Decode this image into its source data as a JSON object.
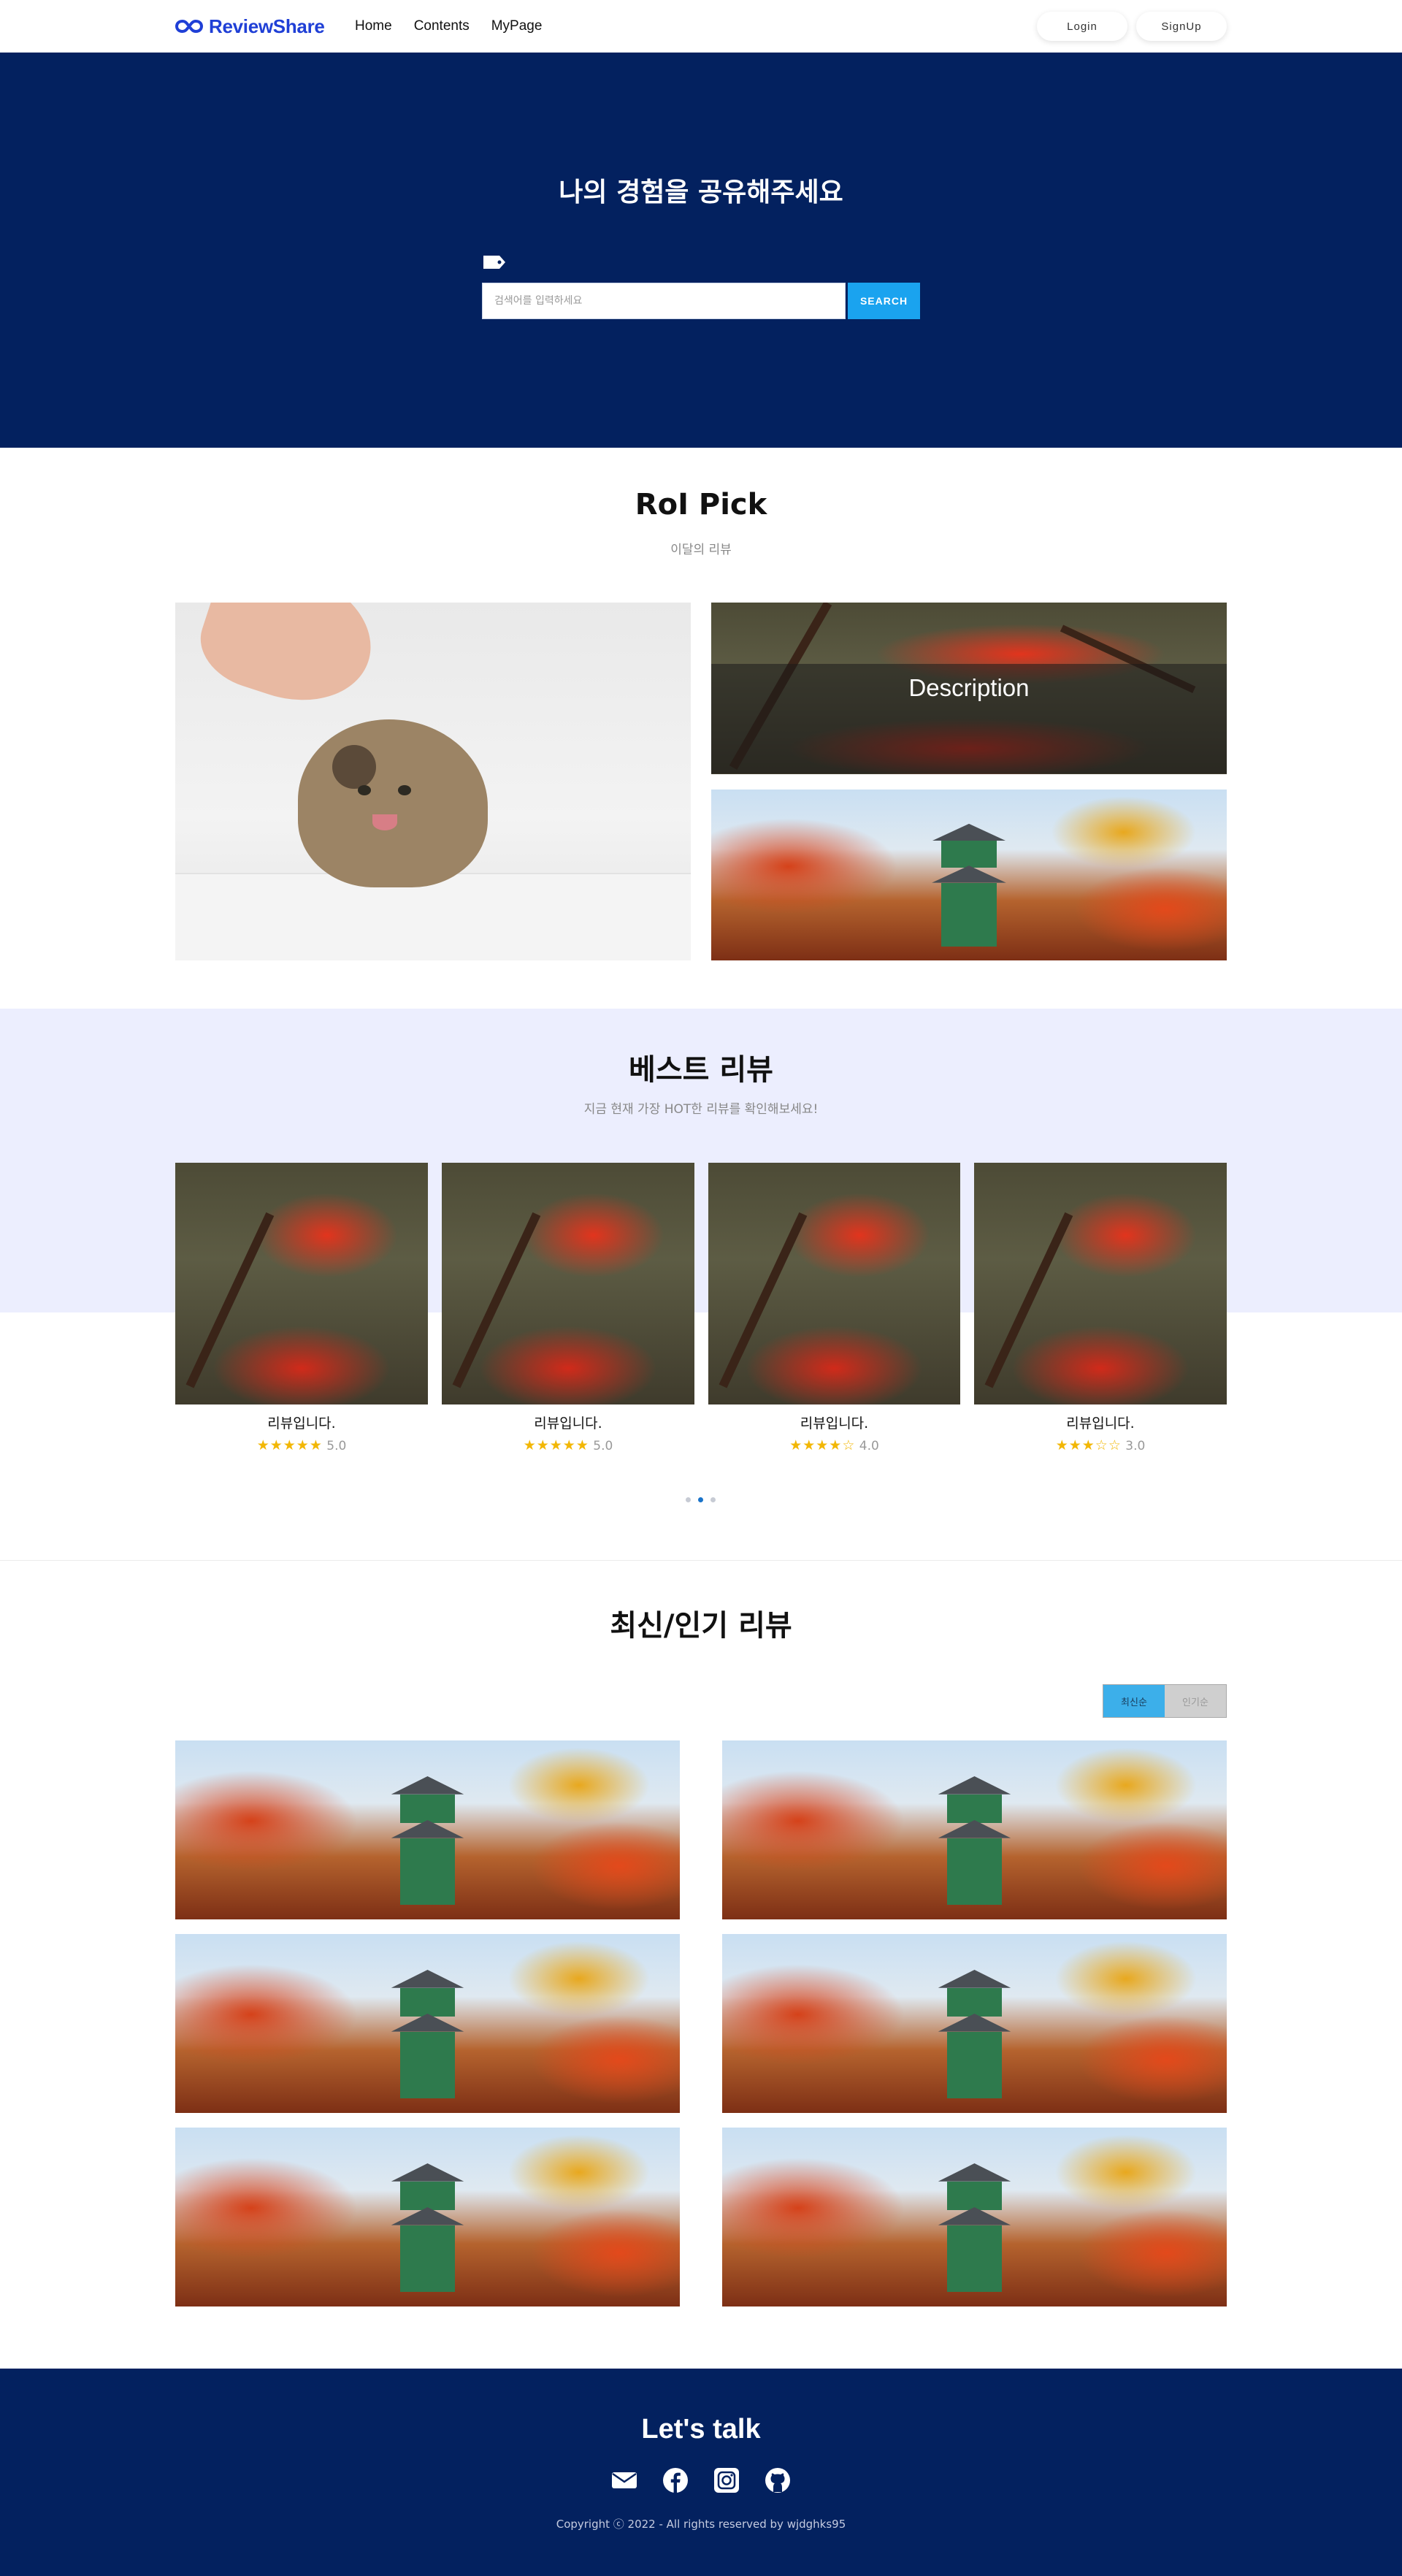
{
  "nav": {
    "brand": "ReviewShare",
    "links": [
      "Home",
      "Contents",
      "MyPage"
    ],
    "login_label": "Login",
    "signup_label": "SignUp"
  },
  "hero": {
    "title": "나의 경험을 공유해주세요",
    "search_placeholder": "검색어를 입력하세요",
    "search_label": "SEARCH"
  },
  "pick": {
    "title": "RoI Pick",
    "subtitle": "이달의 리뷰",
    "description": "Description"
  },
  "best": {
    "title": "베스트 리뷰",
    "subtitle": "지금 현재 가장 HOT한 리뷰를 확인해보세요!",
    "cards": [
      {
        "title": "리뷰입니다.",
        "stars": "★★★★★",
        "score": "5.0"
      },
      {
        "title": "리뷰입니다.",
        "stars": "★★★★★",
        "score": "5.0"
      },
      {
        "title": "리뷰입니다.",
        "stars": "★★★★☆",
        "score": "4.0"
      },
      {
        "title": "리뷰입니다.",
        "stars": "★★★☆☆",
        "score": "3.0"
      }
    ],
    "carousel_active_index": 1
  },
  "latest": {
    "title": "최신/인기 리뷰",
    "sort_latest": "최신순",
    "sort_popular": "인기순"
  },
  "footer": {
    "title": "Let's talk",
    "copyright": "Copyright ⓒ 2022 - All rights reserved by wjdghks95"
  },
  "colors": {
    "navy": "#03215f",
    "brand_blue": "#1f3fd6",
    "accent": "#1aa3ef",
    "band": "#eceefe",
    "star": "#f2b705"
  }
}
